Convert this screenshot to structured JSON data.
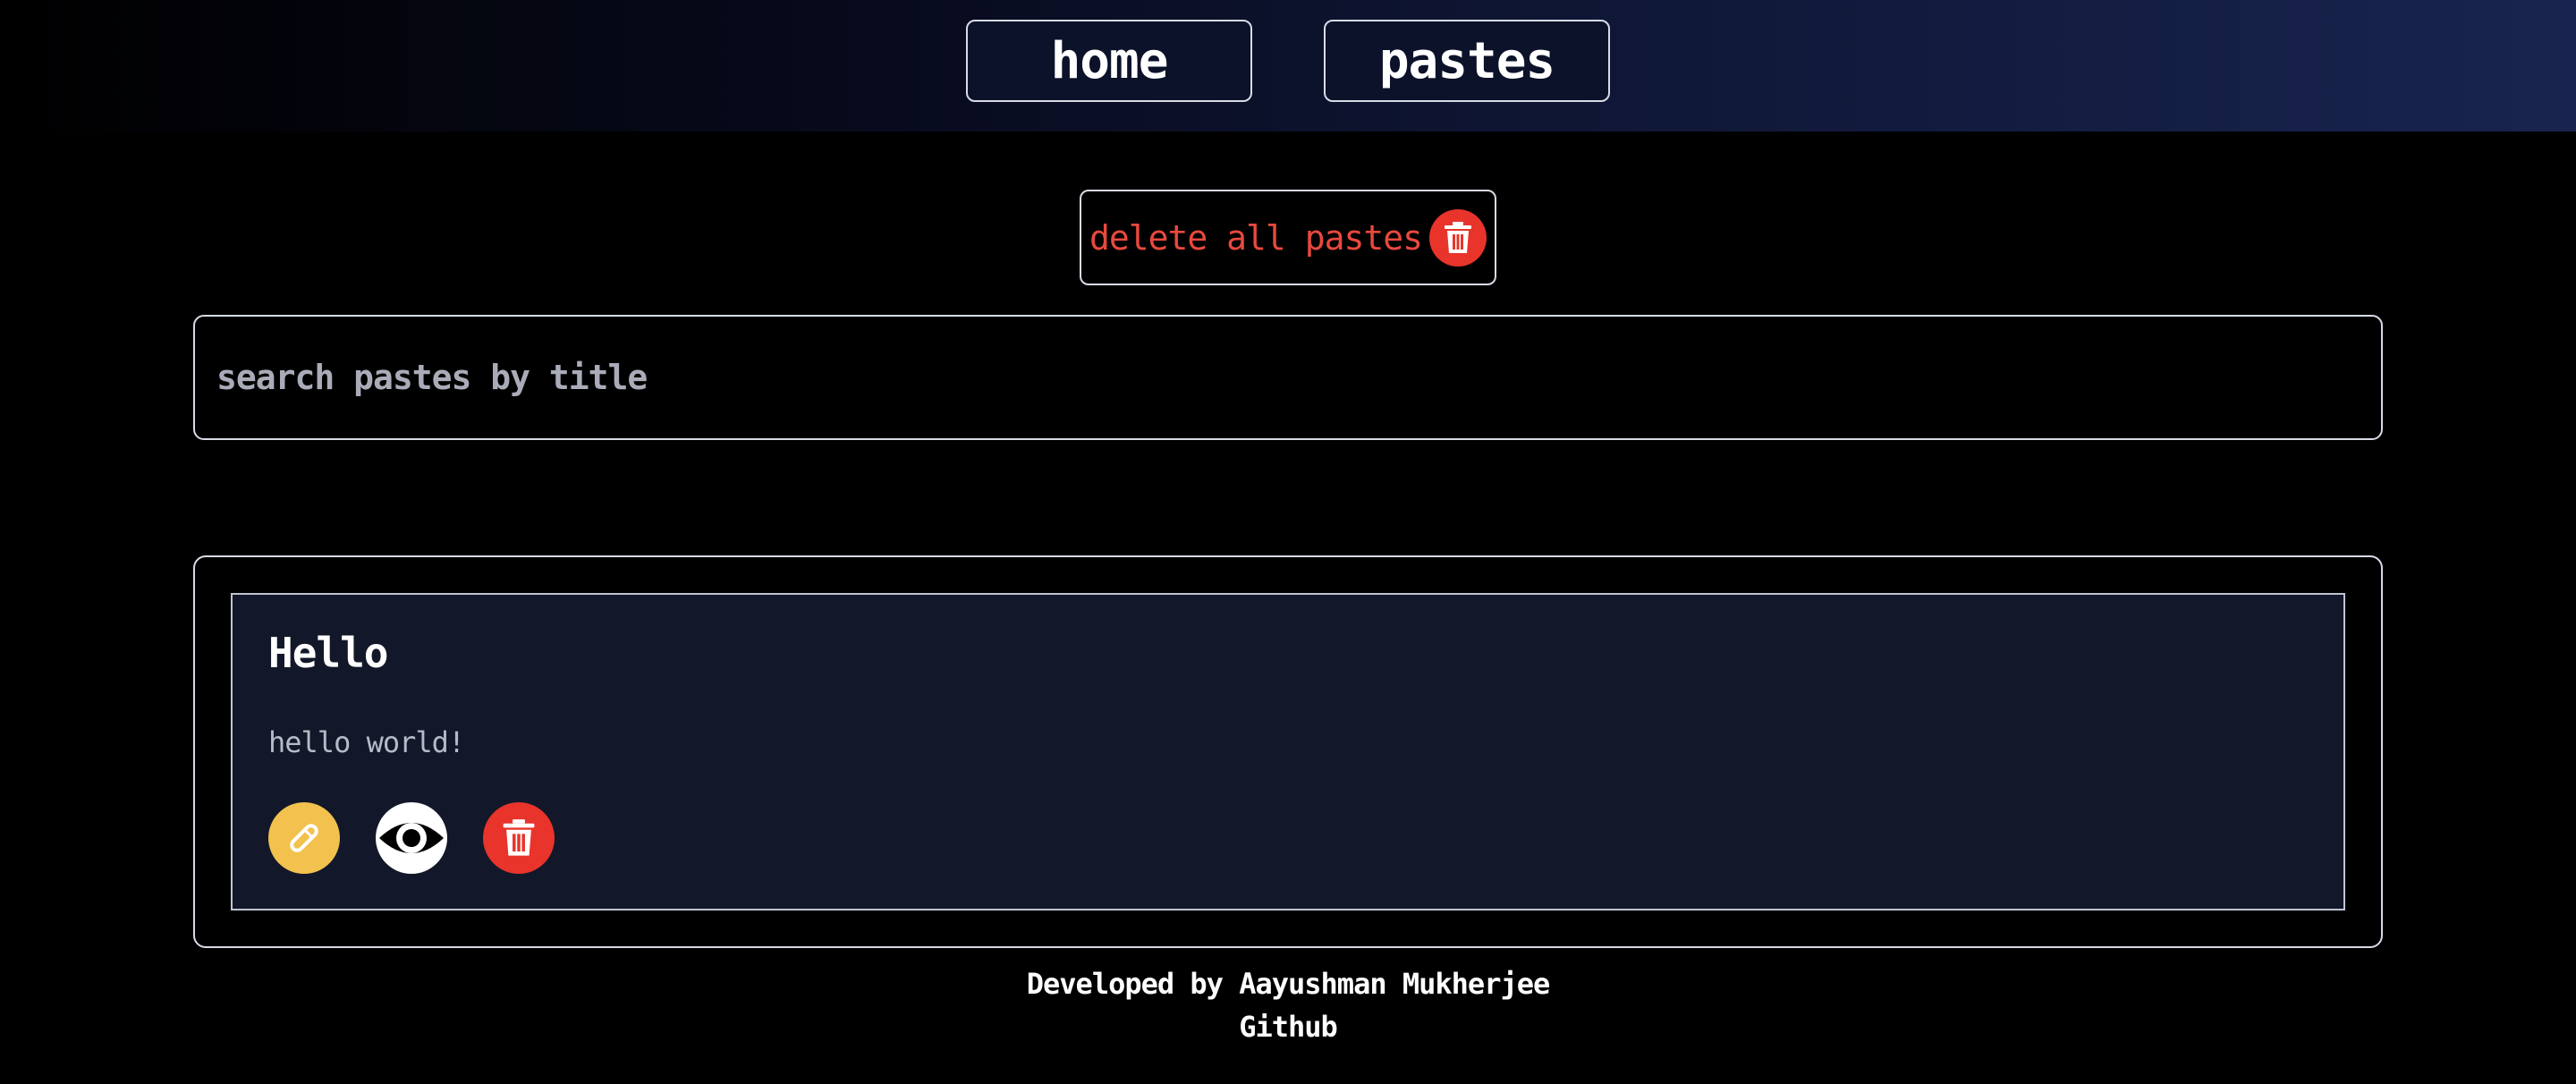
{
  "nav": {
    "home_label": "home",
    "pastes_label": "pastes"
  },
  "actions": {
    "delete_all_label": "delete all pastes"
  },
  "search": {
    "placeholder": "search pastes by title",
    "value": ""
  },
  "pastes": [
    {
      "title": "Hello",
      "content": "hello world!",
      "icons": [
        "pencil-icon",
        "eye-icon",
        "trash-icon"
      ]
    }
  ],
  "footer": {
    "credit": "Developed by Aayushman Mukherjee",
    "github_label": "Github"
  },
  "colors": {
    "background": "#000000",
    "danger": "#e8342b",
    "edit": "#f2c14e",
    "card": "#121829",
    "border": "#d8dbe6"
  }
}
